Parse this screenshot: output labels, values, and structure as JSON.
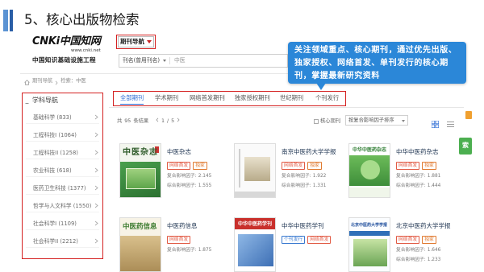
{
  "slide": {
    "title": "5、核心出版物检索"
  },
  "logo": {
    "brand": "CNKi中国知网",
    "url": "www.cnki.net",
    "subtitle": "中国知识基础设施工程"
  },
  "nav_select": {
    "value": "期刊导航"
  },
  "search": {
    "field": "刊名(曾用刊名)",
    "query": "中医"
  },
  "callout": {
    "text": "关注领域重点、核心期刊，通过优先出版、独家授权、网络首发、单刊发行的核心期刊，掌握最新研究资料"
  },
  "breadcrumb": {
    "root": "期刊导航",
    "current": "检索：中医"
  },
  "sidebar": {
    "title": "学科导航",
    "items": [
      {
        "label": "基础科学 (833)"
      },
      {
        "label": "工程科技I (1064)"
      },
      {
        "label": "工程科技II (1258)"
      },
      {
        "label": "农业科技 (618)"
      },
      {
        "label": "医药卫生科技 (1377)"
      },
      {
        "label": "哲学与人文科学 (1550)"
      },
      {
        "label": "社会科学I (1109)"
      },
      {
        "label": "社会科学II (2212)"
      }
    ]
  },
  "tabs": [
    {
      "label": "全部期刊",
      "active": true
    },
    {
      "label": "学术期刊",
      "active": false
    },
    {
      "label": "网络首发期刊",
      "active": false
    },
    {
      "label": "独家授权期刊",
      "active": false
    },
    {
      "label": "世纪期刊",
      "active": false
    },
    {
      "label": "个刊发行",
      "active": false
    }
  ],
  "results": {
    "prefix": "共",
    "total": "95",
    "suffix": "条结果",
    "page": "1",
    "separator": "/",
    "pages": "5",
    "core_filter": "核心期刊",
    "core_checked": false,
    "sort": "按复合影响因子排序",
    "view": "grid"
  },
  "impact_labels": {
    "composite": "复合影响因子:",
    "comprehensive": "综合影响因子:"
  },
  "journals": [
    {
      "title": "中医杂志",
      "cover_text": "中医杂志",
      "tags": [
        {
          "label": "网络首发",
          "color": "#e25b45"
        },
        {
          "label": "独家",
          "color": "#e07a30"
        }
      ],
      "composite": "2.145",
      "comprehensive": "1.555"
    },
    {
      "title": "南京中医药大学学报",
      "tags": [
        {
          "label": "网络首发",
          "color": "#e25b45"
        },
        {
          "label": "独家",
          "color": "#e07a30"
        }
      ],
      "composite": "1.922",
      "comprehensive": "1.331"
    },
    {
      "title": "中华中医药杂志",
      "cover_text": "中华中医药杂志",
      "tags": [
        {
          "label": "网络首发",
          "color": "#e25b45"
        },
        {
          "label": "独家",
          "color": "#e07a30"
        }
      ],
      "composite": "1.881",
      "comprehensive": "1.444"
    },
    {
      "title": "中医药信息",
      "cover_text": "中医药信息",
      "tags": [
        {
          "label": "网络首发",
          "color": "#e25b45"
        }
      ],
      "composite": "1.875"
    },
    {
      "title": "中华中医药学刊",
      "cover_text": "中华中医药学刊",
      "tags": [
        {
          "label": "个刊发行",
          "color": "#3a7ad0"
        },
        {
          "label": "网络首发",
          "color": "#e25b45"
        }
      ]
    },
    {
      "title": "北京中医药大学学报",
      "cover_text": "北京中医药大学学报",
      "tags": [
        {
          "label": "网络首发",
          "color": "#e25b45"
        },
        {
          "label": "独家",
          "color": "#e07a30"
        }
      ],
      "composite": "1.646",
      "comprehensive": "1.233"
    }
  ],
  "side_button": {
    "label": "索"
  },
  "colors": {
    "callout_bg": "#2b87d8",
    "highlight_border": "#d42020",
    "active_tab": "#2a6ad4",
    "title_bar": "#2a5ea6"
  }
}
